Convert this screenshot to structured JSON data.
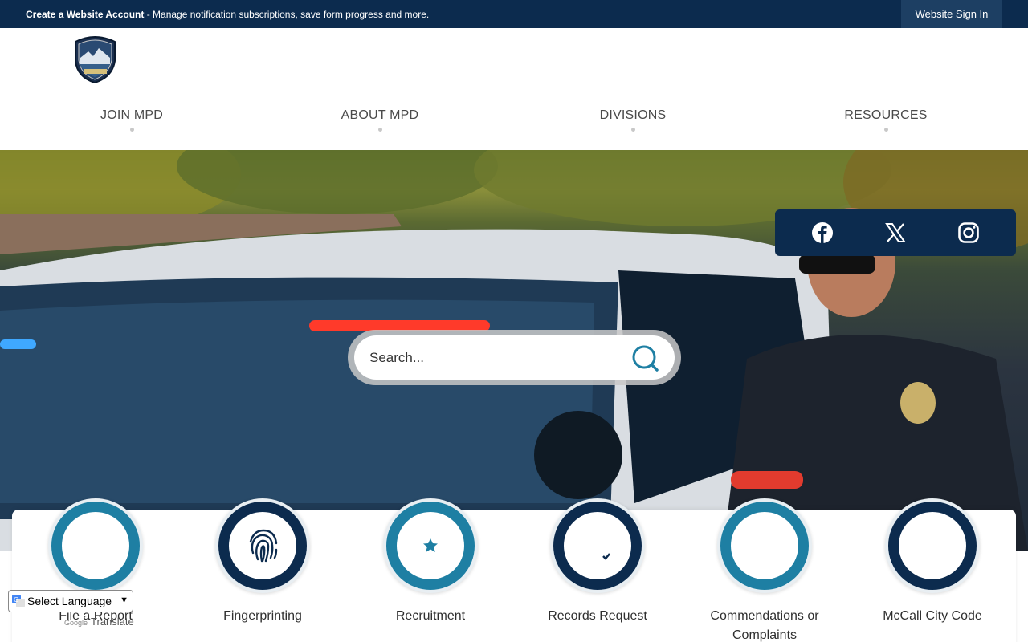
{
  "topbar": {
    "create_account": "Create a Website Account",
    "message": " - Manage notification subscriptions, save form progress and more.",
    "signin": "Website Sign In"
  },
  "nav": {
    "items": [
      {
        "label": "JOIN MPD"
      },
      {
        "label": "ABOUT MPD"
      },
      {
        "label": "DIVISIONS"
      },
      {
        "label": "RESOURCES"
      }
    ]
  },
  "search": {
    "placeholder": "Search..."
  },
  "social": [
    "facebook-icon",
    "x-icon",
    "instagram-icon"
  ],
  "quick_links": [
    {
      "label": "File a Report",
      "icon": "report-icon",
      "color": "#1e7fa3"
    },
    {
      "label": "Fingerprinting",
      "icon": "fingerprint-icon",
      "color": "#0c2b4e"
    },
    {
      "label": "Recruitment",
      "icon": "badge-icon",
      "color": "#1e7fa3"
    },
    {
      "label": "Records Request",
      "icon": "records-icon",
      "color": "#0c2b4e"
    },
    {
      "label": "Commendations or Complaints",
      "icon": "comment-check-icon",
      "color": "#1e7fa3"
    },
    {
      "label": "McCall City Code",
      "icon": "city-code-icon",
      "color": "#0c2b4e"
    }
  ],
  "translate": {
    "select_label": "Select Language",
    "powered_by": "Google",
    "translate_label": "Translate"
  },
  "colors": {
    "navy": "#0c2b4e",
    "teal": "#1e7fa3"
  }
}
